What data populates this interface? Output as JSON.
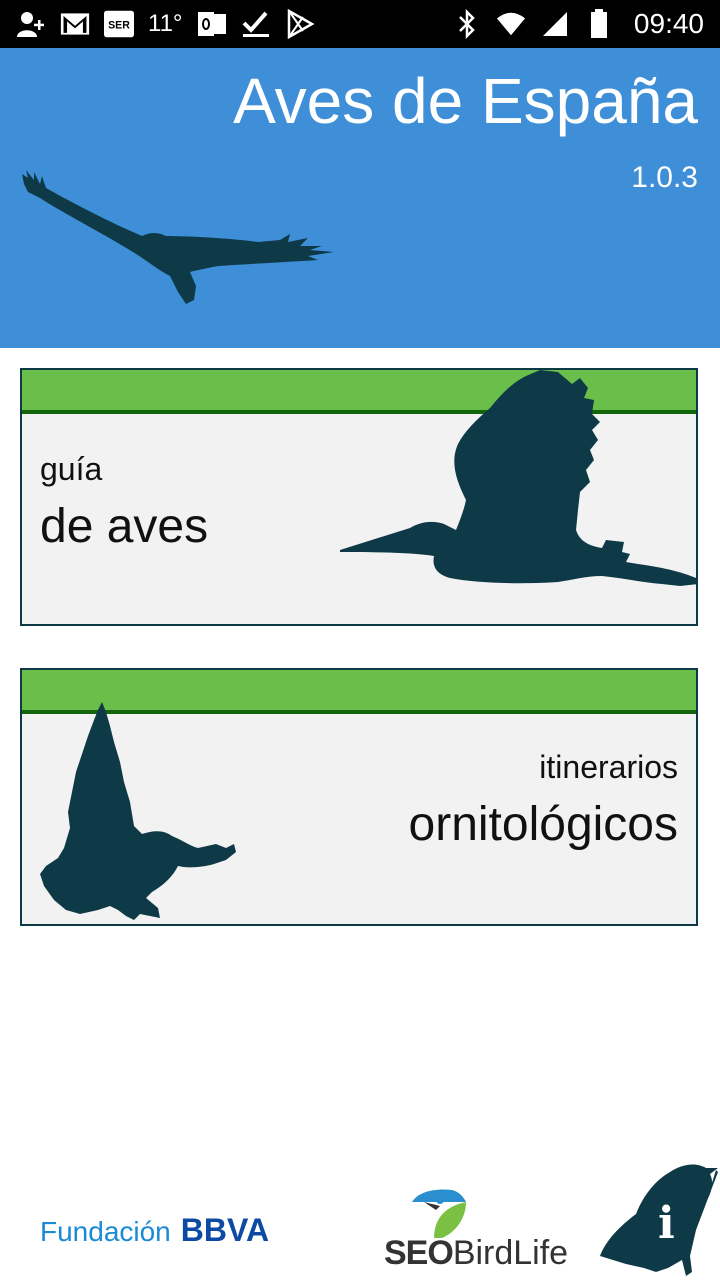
{
  "status_bar": {
    "temperature": "11°",
    "time": "09:40",
    "left_icons": [
      "add-contact-icon",
      "gmail-icon",
      "ser-icon",
      "outlook-icon",
      "check-icon",
      "play-store-icon"
    ],
    "right_icons": [
      "bluetooth-icon",
      "wifi-icon",
      "signal-icon",
      "battery-icon"
    ]
  },
  "header": {
    "title": "Aves de España",
    "version": "1.0.3",
    "background": "#3f8fd8"
  },
  "cards": {
    "guide": {
      "small": "guía",
      "big": "de aves"
    },
    "routes": {
      "small": "itinerarios",
      "big": "ornitológicos"
    }
  },
  "footer": {
    "fundacion": "Fundación",
    "bbva": "BBVA",
    "seo": "SEO",
    "birdlife": "BirdLife"
  },
  "colors": {
    "accent_green": "#6abf4b",
    "silhouette": "#0e3a48"
  }
}
